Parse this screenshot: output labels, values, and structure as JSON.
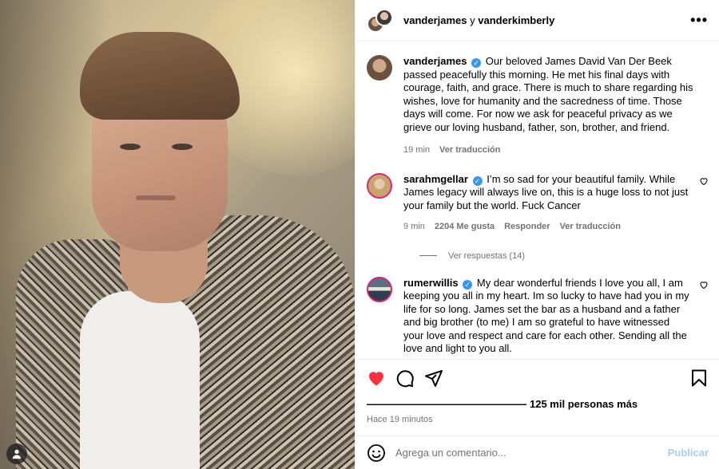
{
  "header": {
    "user1": "vanderjames",
    "joiner": " y ",
    "user2": "vanderkimberly",
    "more_icon": "more-horizontal-icon"
  },
  "caption": {
    "username": "vanderjames",
    "text": "Our beloved James David Van Der Beek passed peacefully this morning. He met his final days with courage, faith, and grace. There is much to share regarding his wishes, love for humanity and the sacredness of time. Those days will come. For now we ask for peaceful privacy as we grieve our loving husband, father, son, brother, and friend.",
    "time": "19 min",
    "translate": "Ver traducción"
  },
  "comments": [
    {
      "username": "sarahmgellar",
      "text": "I’m so sad for your beautiful family. While James legacy will always live on, this is a huge loss to not just your family but the world. Fuck Cancer",
      "time": "9 min",
      "likes": "2204 Me gusta",
      "reply": "Responder",
      "translate": "Ver traducción",
      "view_replies": "Ver respuestas (14)"
    },
    {
      "username": "rumerwillis",
      "text": "My dear wonderful friends I love you all, I am keeping you all in my heart. Im so lucky to have had you in my life for so long. James set the bar as a husband and a father and big brother (to me) I am so grateful to have witnessed your love and respect and care for each other. Sending all the love and light to you all."
    }
  ],
  "actions": {
    "likes_text": "125 mil personas más",
    "timestamp": "Hace 19 minutos"
  },
  "comment_box": {
    "placeholder": "Agrega un comentario...",
    "publish": "Publicar"
  },
  "colors": {
    "heart": "#ff3040",
    "verified": "#3897f0",
    "publish_disabled": "#a8cdf5",
    "muted": "#737373"
  }
}
